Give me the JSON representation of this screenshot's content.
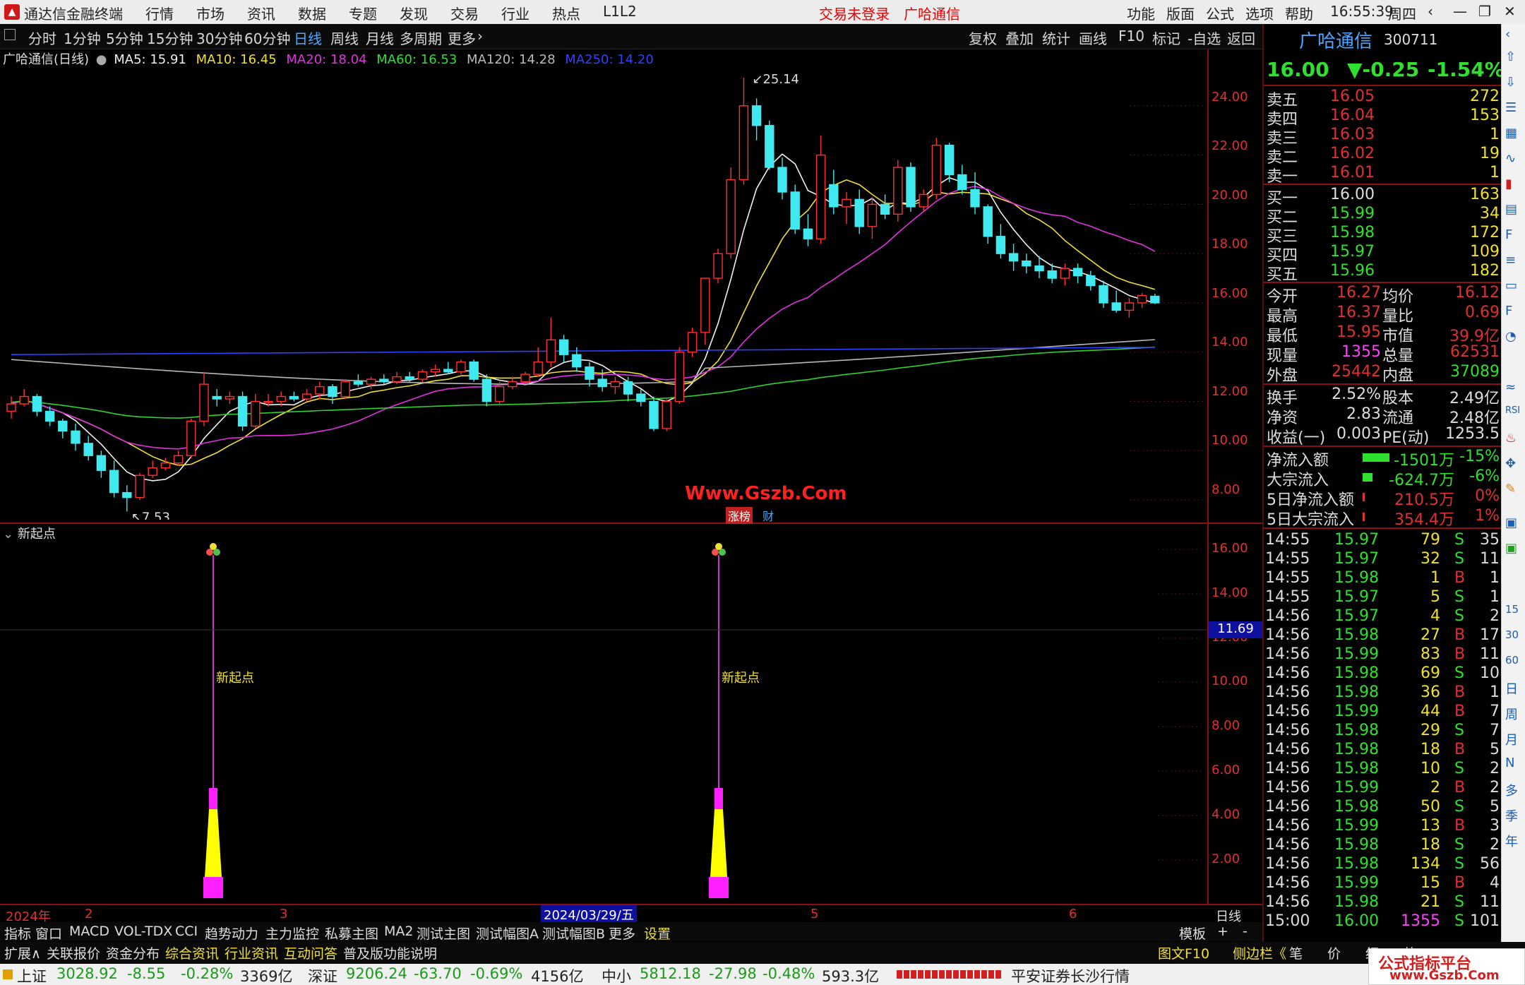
{
  "menubar": {
    "app_title": "通达信金融终端",
    "items": [
      "行情",
      "市场",
      "资讯",
      "数据",
      "专题",
      "发现",
      "交易",
      "行业",
      "热点",
      "L1L2"
    ],
    "login": "交易未登录",
    "stock": "广哈通信",
    "right_items": [
      "功能",
      "版面",
      "公式",
      "选项",
      "帮助"
    ],
    "time": "16:55:39",
    "weekday": "周四"
  },
  "toolbar": {
    "periods": [
      "分时",
      "1分钟",
      "5分钟",
      "15分钟",
      "30分钟",
      "60分钟",
      "日线",
      "周线",
      "月线",
      "多周期",
      "更多"
    ],
    "active": "日线",
    "right": [
      "复权",
      "叠加",
      "统计",
      "画线",
      "F10",
      "标记",
      "-自选",
      "返回"
    ]
  },
  "chart_info": {
    "name": "广哈通信(日线)",
    "ma5": "MA5: 15.91",
    "ma10": "MA10: 16.45",
    "ma20": "MA20: 18.04",
    "ma60": "MA60: 16.53",
    "ma120": "MA120: 14.28",
    "ma250": "MA250: 14.20",
    "high_label": "25.14",
    "low_label": "7.53",
    "watermark": "Www.Gszb.Com",
    "tag1": "涨榜",
    "tag2": "财"
  },
  "indicator": {
    "name": "新起点",
    "signal_label": "新起点",
    "crosshair": "11.69"
  },
  "axis": {
    "main": [
      "24.00",
      "22.00",
      "20.00",
      "18.00",
      "16.00",
      "14.00",
      "12.00",
      "10.00",
      "8.00"
    ],
    "sub": [
      "16.00",
      "14.00",
      "12.00",
      "10.00",
      "8.00",
      "6.00",
      "4.00",
      "2.00"
    ],
    "x": [
      "2024年",
      "2",
      "3",
      "2024/03/29/五",
      "5",
      "6"
    ],
    "period": "日线"
  },
  "bottom_tabs": {
    "row1": [
      "指标",
      "窗口",
      "MACD",
      "VOL-TDX",
      "CCI",
      "趋势动力",
      "主力监控",
      "私募主图",
      "MA2",
      "测试主图",
      "测试幅图A",
      "测试幅图B",
      "更多",
      "设置"
    ],
    "row1_right": [
      "模板",
      "+",
      "-"
    ],
    "row2": [
      "扩展∧",
      "关联报价",
      "资金分布",
      "综合资讯",
      "行业资讯",
      "互动问答",
      "普及版功能说明"
    ],
    "row2_right": [
      "图文F10",
      "侧边栏《",
      "笔",
      "价",
      "细",
      "势"
    ]
  },
  "status": {
    "sh_name": "上证",
    "sh_val": "3028.92",
    "sh_chg": "-8.55",
    "sh_pct": "-0.28%",
    "sh_amt": "3369亿",
    "sz_name": "深证",
    "sz_val": "9206.24",
    "sz_chg": "-63.70",
    "sz_pct": "-0.69%",
    "sz_amt": "4156亿",
    "zx_name": "中小",
    "zx_val": "5812.18",
    "zx_chg": "-27.98",
    "zx_pct": "-0.48%",
    "zx_amt": "593.3亿",
    "broker": "平安证券长沙行情",
    "logo_text": "公式指标平台",
    "logo_url": "www.Gszb.Com"
  },
  "quote": {
    "name": "广哈通信",
    "code": "300711",
    "price": "16.00",
    "change": "▼-0.25",
    "pct": "-1.54%",
    "asks": [
      {
        "l": "卖五",
        "p": "16.05",
        "v": "272"
      },
      {
        "l": "卖四",
        "p": "16.04",
        "v": "153"
      },
      {
        "l": "卖三",
        "p": "16.03",
        "v": "1"
      },
      {
        "l": "卖二",
        "p": "16.02",
        "v": "19"
      },
      {
        "l": "卖一",
        "p": "16.01",
        "v": "1"
      }
    ],
    "bids": [
      {
        "l": "买一",
        "p": "16.00",
        "v": "163"
      },
      {
        "l": "买二",
        "p": "15.99",
        "v": "34"
      },
      {
        "l": "买三",
        "p": "15.98",
        "v": "172"
      },
      {
        "l": "买四",
        "p": "15.97",
        "v": "109"
      },
      {
        "l": "买五",
        "p": "15.96",
        "v": "182"
      }
    ],
    "stats": [
      [
        "今开",
        "16.27",
        "均价",
        "16.12"
      ],
      [
        "最高",
        "16.37",
        "量比",
        "0.69"
      ],
      [
        "最低",
        "15.95",
        "市值",
        "39.9亿"
      ],
      [
        "现量",
        "1355",
        "总量",
        "62531"
      ],
      [
        "外盘",
        "25442",
        "内盘",
        "37089"
      ]
    ],
    "stats2": [
      [
        "换手",
        "2.52%",
        "股本",
        "2.49亿"
      ],
      [
        "净资",
        "2.83",
        "流通",
        "2.48亿"
      ],
      [
        "收益(一)",
        "0.003",
        "PE(动)",
        "1253.5"
      ]
    ],
    "flows": [
      [
        "净流入额",
        "-1501万",
        "-15%"
      ],
      [
        "大宗流入",
        "-624.7万",
        "-6%"
      ],
      [
        "5日净流入额",
        "210.5万",
        "0%"
      ],
      [
        "5日大宗流入",
        "354.4万",
        "1%"
      ]
    ],
    "ticks": [
      [
        "14:55",
        "15.97",
        "79",
        "S",
        "35"
      ],
      [
        "14:55",
        "15.97",
        "32",
        "S",
        "11"
      ],
      [
        "14:55",
        "15.98",
        "1",
        "B",
        "1"
      ],
      [
        "14:55",
        "15.97",
        "5",
        "S",
        "1"
      ],
      [
        "14:56",
        "15.97",
        "4",
        "S",
        "2"
      ],
      [
        "14:56",
        "15.98",
        "27",
        "B",
        "17"
      ],
      [
        "14:56",
        "15.99",
        "83",
        "B",
        "11"
      ],
      [
        "14:56",
        "15.98",
        "69",
        "S",
        "10"
      ],
      [
        "14:56",
        "15.98",
        "36",
        "B",
        "1"
      ],
      [
        "14:56",
        "15.99",
        "44",
        "B",
        "7"
      ],
      [
        "14:56",
        "15.98",
        "29",
        "S",
        "7"
      ],
      [
        "14:56",
        "15.98",
        "18",
        "B",
        "5"
      ],
      [
        "14:56",
        "15.98",
        "10",
        "S",
        "2"
      ],
      [
        "14:56",
        "15.99",
        "2",
        "B",
        "2"
      ],
      [
        "14:56",
        "15.98",
        "50",
        "S",
        "5"
      ],
      [
        "14:56",
        "15.99",
        "13",
        "B",
        "3"
      ],
      [
        "14:56",
        "15.98",
        "18",
        "S",
        "2"
      ],
      [
        "14:56",
        "15.98",
        "134",
        "S",
        "56"
      ],
      [
        "14:56",
        "15.99",
        "15",
        "B",
        "4"
      ],
      [
        "14:56",
        "15.98",
        "21",
        "S",
        "11"
      ],
      [
        "15:00",
        "16.00",
        "1355",
        "S",
        "101"
      ]
    ]
  },
  "side_icons": [
    "15",
    "30",
    "60",
    "日",
    "周",
    "月",
    "N",
    "多",
    "季",
    "年"
  ],
  "chart_data": {
    "type": "candlestick",
    "x_range": [
      "2024年",
      "6"
    ],
    "y_range": [
      7.53,
      25.14
    ],
    "labels": {
      "high": "25.14",
      "low": "7.53"
    },
    "candles": [
      [
        11.6,
        12.2,
        11.3,
        11.9
      ],
      [
        11.9,
        12.5,
        11.8,
        12.2
      ],
      [
        12.2,
        12.3,
        11.4,
        11.6
      ],
      [
        11.6,
        11.8,
        11.0,
        11.2
      ],
      [
        11.2,
        11.3,
        10.5,
        10.8
      ],
      [
        10.8,
        11.1,
        10.0,
        10.3
      ],
      [
        10.3,
        10.6,
        9.6,
        9.8
      ],
      [
        9.8,
        10.0,
        8.9,
        9.2
      ],
      [
        9.2,
        9.6,
        8.1,
        8.3
      ],
      [
        8.3,
        8.6,
        7.53,
        8.1
      ],
      [
        8.1,
        9.1,
        8.0,
        9.0
      ],
      [
        9.0,
        9.6,
        8.9,
        9.3
      ],
      [
        9.3,
        9.7,
        9.2,
        9.5
      ],
      [
        9.5,
        10.0,
        9.4,
        9.8
      ],
      [
        9.8,
        11.3,
        9.7,
        11.2
      ],
      [
        11.2,
        13.2,
        11.0,
        12.7
      ],
      [
        12.2,
        12.5,
        11.8,
        12.1
      ],
      [
        12.1,
        12.4,
        11.9,
        12.2
      ],
      [
        12.2,
        12.4,
        10.8,
        11.0
      ],
      [
        11.0,
        12.3,
        10.9,
        12.0
      ],
      [
        12.0,
        12.3,
        11.8,
        12.0
      ],
      [
        12.0,
        12.4,
        11.8,
        12.2
      ],
      [
        12.2,
        12.4,
        12.0,
        12.1
      ],
      [
        12.1,
        12.5,
        12.0,
        12.3
      ],
      [
        12.3,
        12.8,
        12.1,
        12.6
      ],
      [
        12.6,
        12.7,
        11.9,
        12.2
      ],
      [
        12.2,
        12.9,
        12.1,
        12.8
      ],
      [
        12.8,
        13.1,
        12.6,
        12.7
      ],
      [
        12.7,
        13.0,
        12.5,
        12.9
      ],
      [
        12.9,
        13.1,
        12.7,
        12.8
      ],
      [
        12.8,
        13.2,
        12.7,
        13.0
      ],
      [
        13.0,
        13.2,
        12.8,
        12.9
      ],
      [
        12.9,
        13.3,
        12.8,
        13.2
      ],
      [
        13.2,
        13.5,
        13.0,
        13.3
      ],
      [
        13.3,
        13.6,
        13.1,
        13.2
      ],
      [
        13.2,
        13.7,
        13.1,
        13.6
      ],
      [
        13.6,
        13.7,
        12.8,
        12.9
      ],
      [
        12.9,
        13.1,
        11.8,
        12.0
      ],
      [
        12.0,
        12.8,
        11.9,
        12.6
      ],
      [
        12.6,
        13.0,
        12.5,
        12.8
      ],
      [
        12.8,
        13.2,
        12.7,
        13.1
      ],
      [
        13.1,
        14.2,
        13.0,
        13.6
      ],
      [
        13.6,
        15.4,
        13.4,
        14.5
      ],
      [
        14.5,
        14.7,
        13.6,
        13.9
      ],
      [
        13.9,
        14.2,
        13.2,
        13.4
      ],
      [
        13.4,
        13.6,
        12.6,
        12.9
      ],
      [
        12.9,
        13.3,
        12.4,
        12.6
      ],
      [
        12.6,
        13.0,
        12.3,
        12.8
      ],
      [
        12.8,
        13.0,
        12.0,
        12.3
      ],
      [
        12.3,
        12.5,
        11.8,
        12.0
      ],
      [
        12.0,
        12.2,
        10.8,
        10.9
      ],
      [
        10.9,
        12.1,
        10.8,
        12.0
      ],
      [
        12.0,
        14.2,
        11.9,
        14.0
      ],
      [
        14.0,
        15.0,
        13.8,
        14.8
      ],
      [
        14.8,
        15.6,
        14.3,
        17.0
      ],
      [
        17.0,
        18.2,
        16.8,
        18.0
      ],
      [
        18.0,
        21.5,
        17.8,
        21.0
      ],
      [
        21.0,
        25.14,
        20.8,
        24.0
      ],
      [
        24.0,
        24.3,
        22.6,
        23.2
      ],
      [
        23.2,
        23.4,
        21.4,
        21.5
      ],
      [
        21.5,
        21.9,
        20.2,
        20.5
      ],
      [
        20.5,
        20.8,
        18.8,
        19.0
      ],
      [
        19.0,
        19.6,
        18.3,
        18.6
      ],
      [
        18.6,
        22.8,
        18.4,
        22.0
      ],
      [
        20.8,
        21.4,
        19.6,
        19.9
      ],
      [
        19.9,
        20.5,
        19.2,
        20.2
      ],
      [
        20.2,
        20.6,
        18.8,
        19.1
      ],
      [
        19.1,
        20.3,
        18.6,
        20.0
      ],
      [
        20.0,
        20.4,
        19.4,
        19.6
      ],
      [
        19.6,
        21.8,
        19.3,
        21.5
      ],
      [
        21.5,
        21.7,
        19.7,
        19.9
      ],
      [
        19.9,
        20.6,
        19.7,
        20.4
      ],
      [
        20.4,
        22.7,
        20.2,
        22.4
      ],
      [
        22.4,
        22.5,
        20.9,
        21.2
      ],
      [
        21.2,
        21.6,
        20.4,
        20.6
      ],
      [
        20.6,
        21.3,
        19.6,
        19.9
      ],
      [
        19.9,
        20.0,
        18.4,
        18.7
      ],
      [
        18.7,
        19.2,
        17.8,
        18.0
      ],
      [
        18.0,
        18.4,
        17.3,
        17.7
      ],
      [
        17.7,
        18.0,
        17.2,
        17.5
      ],
      [
        17.5,
        17.9,
        17.0,
        17.3
      ],
      [
        17.3,
        17.6,
        16.8,
        17.0
      ],
      [
        17.0,
        17.6,
        16.7,
        17.4
      ],
      [
        17.4,
        17.6,
        16.8,
        17.1
      ],
      [
        17.1,
        17.3,
        16.5,
        16.7
      ],
      [
        16.7,
        16.9,
        15.8,
        16.0
      ],
      [
        16.0,
        16.5,
        15.6,
        15.7
      ],
      [
        15.7,
        16.2,
        15.4,
        16.0
      ],
      [
        16.0,
        16.4,
        15.8,
        16.3
      ],
      [
        16.27,
        16.37,
        15.95,
        16.0
      ]
    ]
  }
}
